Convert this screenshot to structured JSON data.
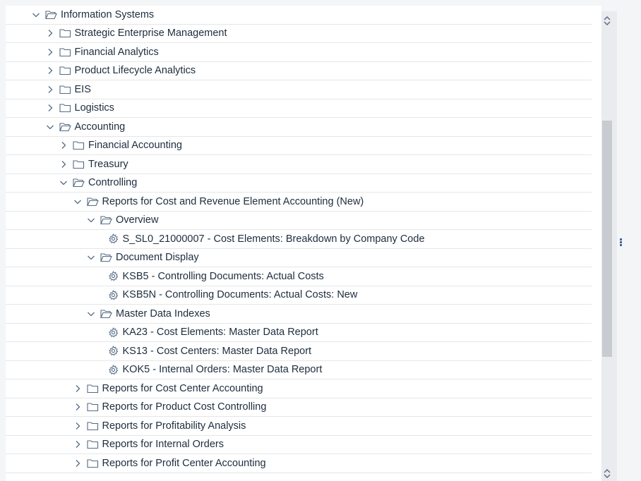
{
  "tree": {
    "rows": [
      {
        "label": "Information Systems",
        "level": 0,
        "type": "folder",
        "state": "expanded"
      },
      {
        "label": "Strategic Enterprise Management",
        "level": 1,
        "type": "folder",
        "state": "collapsed"
      },
      {
        "label": "Financial Analytics",
        "level": 1,
        "type": "folder",
        "state": "collapsed"
      },
      {
        "label": "Product Lifecycle Analytics",
        "level": 1,
        "type": "folder",
        "state": "collapsed"
      },
      {
        "label": "EIS",
        "level": 1,
        "type": "folder",
        "state": "collapsed"
      },
      {
        "label": "Logistics",
        "level": 1,
        "type": "folder",
        "state": "collapsed"
      },
      {
        "label": "Accounting",
        "level": 1,
        "type": "folder",
        "state": "expanded"
      },
      {
        "label": "Financial Accounting",
        "level": 2,
        "type": "folder",
        "state": "collapsed"
      },
      {
        "label": "Treasury",
        "level": 2,
        "type": "folder",
        "state": "collapsed"
      },
      {
        "label": "Controlling",
        "level": 2,
        "type": "folder",
        "state": "expanded"
      },
      {
        "label": "Reports for Cost and Revenue Element Accounting (New)",
        "level": 3,
        "type": "folder",
        "state": "expanded"
      },
      {
        "label": "Overview",
        "level": 4,
        "type": "folder",
        "state": "expanded"
      },
      {
        "label": "S_SL0_21000007 - Cost Elements: Breakdown by Company Code",
        "level": 5,
        "type": "transaction"
      },
      {
        "label": "Document Display",
        "level": 4,
        "type": "folder",
        "state": "expanded"
      },
      {
        "label": "KSB5 - Controlling Documents: Actual Costs",
        "level": 5,
        "type": "transaction"
      },
      {
        "label": "KSB5N - Controlling Documents: Actual Costs: New",
        "level": 5,
        "type": "transaction"
      },
      {
        "label": "Master Data Indexes",
        "level": 4,
        "type": "folder",
        "state": "expanded"
      },
      {
        "label": "KA23 - Cost Elements: Master Data Report",
        "level": 5,
        "type": "transaction"
      },
      {
        "label": "KS13 - Cost Centers: Master Data Report",
        "level": 5,
        "type": "transaction"
      },
      {
        "label": "KOK5 - Internal Orders: Master Data Report",
        "level": 5,
        "type": "transaction"
      },
      {
        "label": "Reports for Cost Center Accounting",
        "level": 3,
        "type": "folder",
        "state": "collapsed"
      },
      {
        "label": "Reports for Product Cost Controlling",
        "level": 3,
        "type": "folder",
        "state": "collapsed"
      },
      {
        "label": "Reports for Profitability Analysis",
        "level": 3,
        "type": "folder",
        "state": "collapsed"
      },
      {
        "label": "Reports for Internal Orders",
        "level": 3,
        "type": "folder",
        "state": "collapsed"
      },
      {
        "label": "Reports for Profit Center Accounting",
        "level": 3,
        "type": "folder",
        "state": "collapsed"
      }
    ]
  },
  "colors": {
    "text": "#1d2d3e",
    "icon": "#556b82",
    "row_border": "#e3e6ea",
    "accent": "#42669c"
  }
}
